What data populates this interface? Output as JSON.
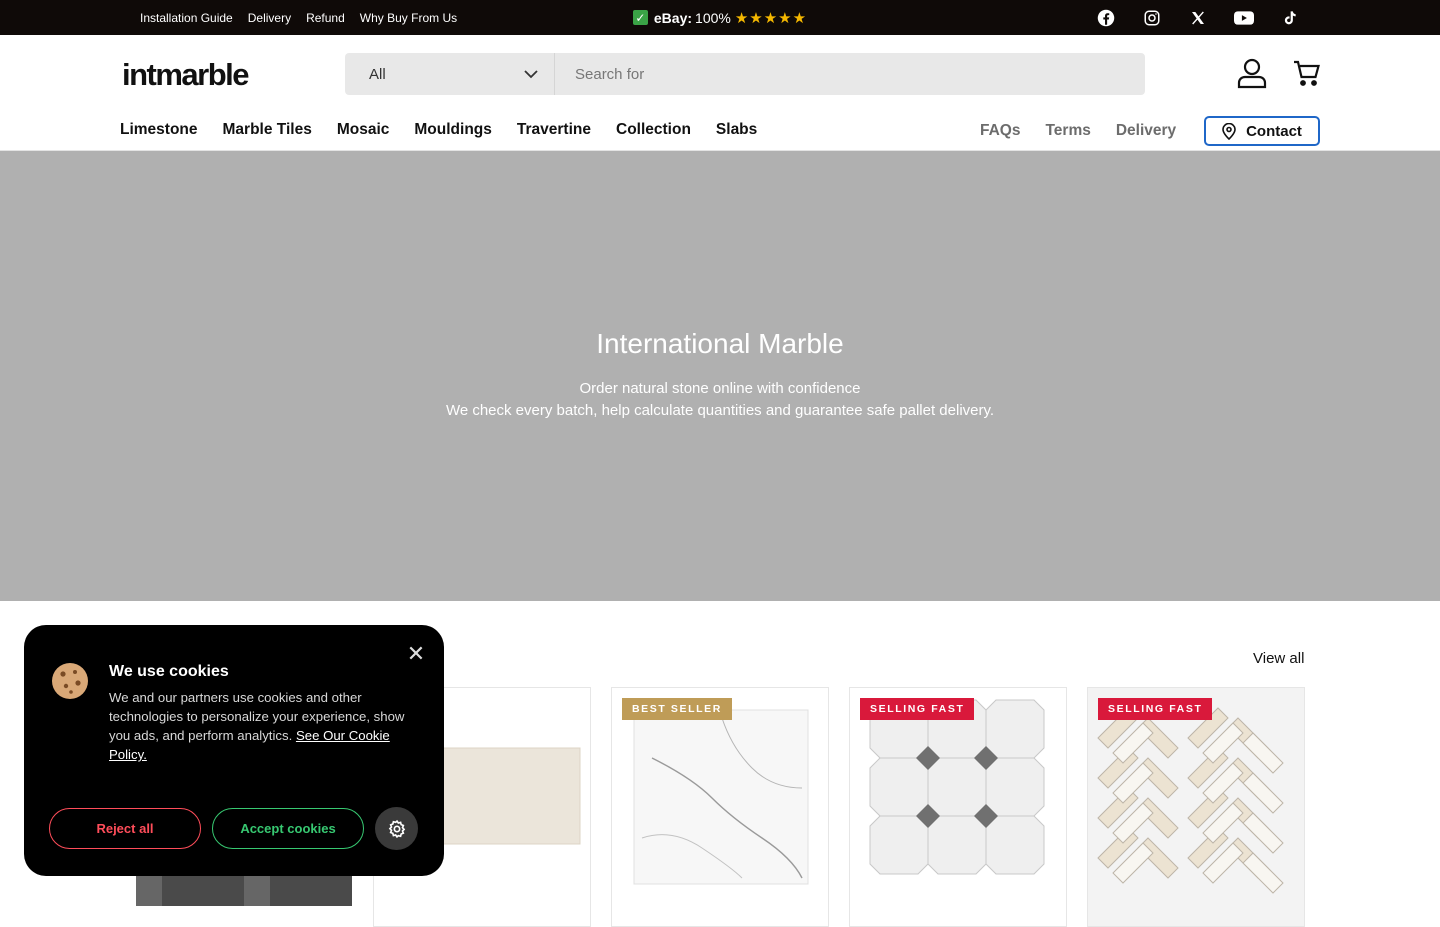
{
  "announcement": {
    "links": [
      "Installation Guide",
      "Delivery",
      "Refund",
      "Why Buy From Us"
    ],
    "ebay_label": "eBay:",
    "ebay_score": "100%",
    "stars": "★★★★★"
  },
  "socials": [
    "facebook-icon",
    "instagram-icon",
    "x-icon",
    "youtube-icon",
    "tiktok-icon"
  ],
  "header": {
    "logo": "intmarble",
    "search": {
      "category": "All",
      "placeholder": "Search for"
    },
    "main_nav": [
      "Limestone",
      "Marble Tiles",
      "Mosaic",
      "Mouldings",
      "Travertine",
      "Collection",
      "Slabs"
    ],
    "sub_nav": [
      "FAQs",
      "Terms",
      "Delivery"
    ],
    "contact": "Contact"
  },
  "hero": {
    "title": "International Marble",
    "line1": "Order natural stone online with confidence",
    "line2": "We check every batch, help calculate quantities and guarantee safe pallet delivery."
  },
  "products": {
    "view_all": "View all",
    "badges": [
      "BEST SELLER",
      "SELLING FAST",
      "SELLING FAST"
    ]
  },
  "cookie": {
    "title": "We use cookies",
    "body": "We and our partners use cookies and other technologies to personalize your experience, show you ads, and perform analytics.",
    "policy_link": "See Our Cookie Policy.",
    "reject": "Reject all",
    "accept": "Accept cookies"
  },
  "colors": {
    "topbar": "#0f0a08",
    "hero_bg": "#b0b0b0",
    "contact_border": "#1f67c8",
    "badge_gold": "#bf9c57",
    "badge_red": "#d9193b",
    "reject": "#ff4d5a",
    "accept": "#37c871"
  }
}
